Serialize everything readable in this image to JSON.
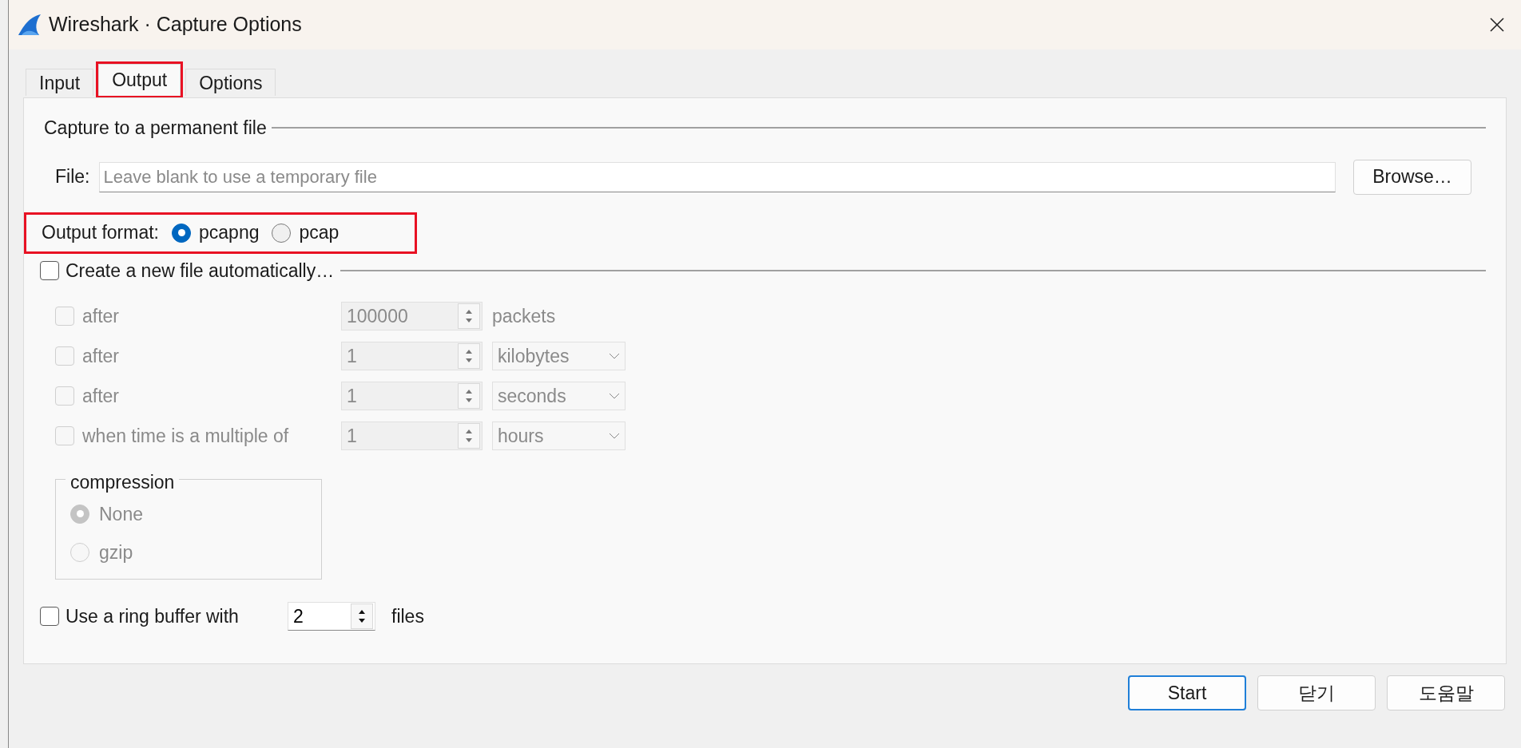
{
  "window": {
    "title": "Wireshark · Capture Options"
  },
  "tabs": [
    {
      "label": "Input",
      "selected": false,
      "highlighted": false
    },
    {
      "label": "Output",
      "selected": true,
      "highlighted": true
    },
    {
      "label": "Options",
      "selected": false,
      "highlighted": false
    }
  ],
  "capture_section": {
    "title": "Capture to a permanent file",
    "file_label": "File:",
    "placeholder": "Leave blank to use a temporary file",
    "browse_button": "Browse…"
  },
  "output_format": {
    "label": "Output format:",
    "highlighted": true,
    "options": [
      {
        "label": "pcapng",
        "selected": true
      },
      {
        "label": "pcap",
        "selected": false
      }
    ]
  },
  "auto_file": {
    "label": "Create a new file automatically…",
    "checked": false,
    "conditions": [
      {
        "kind": "text",
        "label": "after",
        "checked": false,
        "disabled": true,
        "value": "100000",
        "unit": "packets"
      },
      {
        "kind": "dropdown",
        "label": "after",
        "checked": false,
        "disabled": true,
        "value": "1",
        "unit": "kilobytes"
      },
      {
        "kind": "dropdown",
        "label": "after",
        "checked": false,
        "disabled": true,
        "value": "1",
        "unit": "seconds"
      },
      {
        "kind": "dropdown",
        "label": "when time is a multiple of",
        "checked": false,
        "disabled": true,
        "value": "1",
        "unit": "hours"
      }
    ],
    "compression": {
      "title": "compression",
      "disabled": true,
      "options": [
        {
          "label": "None",
          "selected": true
        },
        {
          "label": "gzip",
          "selected": false
        }
      ]
    }
  },
  "ring_buffer": {
    "label": "Use a ring buffer with",
    "checked": false,
    "value": "2",
    "unit": "files"
  },
  "buttons": [
    {
      "label": "Start",
      "default": true
    },
    {
      "label": "닫기",
      "default": false
    },
    {
      "label": "도움말",
      "default": false
    }
  ]
}
